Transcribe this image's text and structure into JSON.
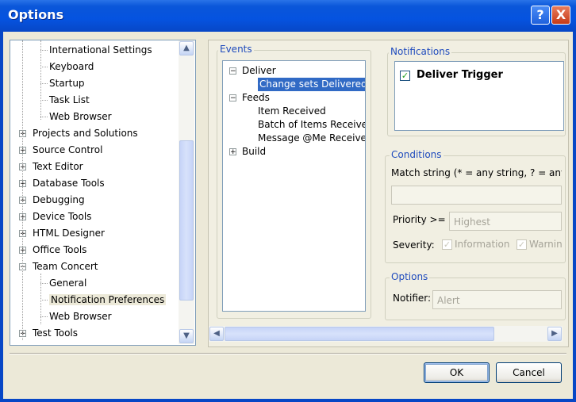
{
  "window": {
    "title": "Options",
    "help_glyph": "?",
    "close_glyph": "X"
  },
  "tree": {
    "items": [
      {
        "label": "International Settings",
        "level": 1
      },
      {
        "label": "Keyboard",
        "level": 1
      },
      {
        "label": "Startup",
        "level": 1
      },
      {
        "label": "Task List",
        "level": 1
      },
      {
        "label": "Web Browser",
        "level": 1
      },
      {
        "label": "Projects and Solutions",
        "level": 0,
        "expander": "+"
      },
      {
        "label": "Source Control",
        "level": 0,
        "expander": "+"
      },
      {
        "label": "Text Editor",
        "level": 0,
        "expander": "+"
      },
      {
        "label": "Database Tools",
        "level": 0,
        "expander": "+"
      },
      {
        "label": "Debugging",
        "level": 0,
        "expander": "+"
      },
      {
        "label": "Device Tools",
        "level": 0,
        "expander": "+"
      },
      {
        "label": "HTML Designer",
        "level": 0,
        "expander": "+"
      },
      {
        "label": "Office Tools",
        "level": 0,
        "expander": "+"
      },
      {
        "label": "Team Concert",
        "level": 0,
        "expander": "−"
      },
      {
        "label": "General",
        "level": 1
      },
      {
        "label": "Notification Preferences",
        "level": 1,
        "selected": true
      },
      {
        "label": "Web Browser",
        "level": 1
      },
      {
        "label": "Test Tools",
        "level": 0,
        "expander": "+"
      }
    ],
    "scroll_up": "▲",
    "scroll_down": "▼"
  },
  "events": {
    "label": "Events",
    "items": [
      {
        "label": "Deliver",
        "level": 0,
        "expander": "−"
      },
      {
        "label": "Change sets Delivered",
        "level": 1,
        "selected": true
      },
      {
        "label": "Feeds",
        "level": 0,
        "expander": "−"
      },
      {
        "label": "Item Received",
        "level": 1
      },
      {
        "label": "Batch of Items Received",
        "level": 1
      },
      {
        "label": "Message @Me Received",
        "level": 1
      },
      {
        "label": "Build",
        "level": 0,
        "expander": "+"
      }
    ]
  },
  "notifications": {
    "label": "Notifications",
    "deliver_trigger": {
      "label": "Deliver Trigger",
      "checked": true,
      "check_glyph": "✓"
    }
  },
  "conditions": {
    "label": "Conditions",
    "match_string_label": "Match string (* = any string, ? = any ch",
    "match_string_value": "",
    "priority_label": "Priority >=",
    "priority_value": "Highest",
    "severity_label": "Severity:",
    "severity_information": "Information",
    "severity_warning": "Warning"
  },
  "options": {
    "label": "Options",
    "notifier_label": "Notifier:",
    "notifier_value": "Alert"
  },
  "hscroll": {
    "left": "◀",
    "right": "▶"
  },
  "buttons": {
    "ok": "OK",
    "cancel": "Cancel"
  },
  "colors": {
    "titlebar": "#0553e0",
    "selection": "#316ac5",
    "group_label": "#1f4bbd",
    "check": "#21a121"
  }
}
